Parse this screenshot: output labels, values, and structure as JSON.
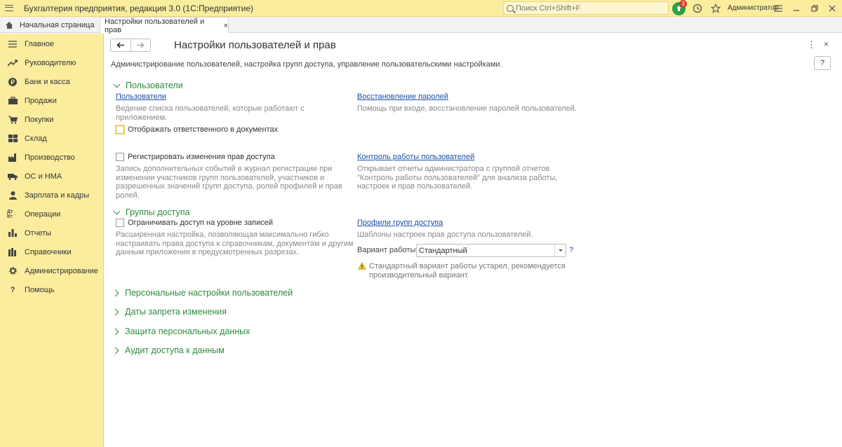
{
  "app": {
    "title": "Бухгалтерия предприятия, редакция 3.0  (1С:Предприятие)",
    "search_placeholder": "Поиск Ctrl+Shift+F",
    "notifications_count": "3",
    "user": "Администратор"
  },
  "tabs": {
    "home": "Начальная страница",
    "active": "Настройки пользователей и прав",
    "close": "×"
  },
  "sidebar": {
    "items": [
      {
        "label": "Главное",
        "icon": "menu-lines-icon"
      },
      {
        "label": "Руководителю",
        "icon": "trend-icon"
      },
      {
        "label": "Банк и касса",
        "icon": "ruble-icon"
      },
      {
        "label": "Продажи",
        "icon": "briefcase-icon"
      },
      {
        "label": "Покупки",
        "icon": "cart-icon"
      },
      {
        "label": "Склад",
        "icon": "warehouse-icon"
      },
      {
        "label": "Производство",
        "icon": "factory-icon"
      },
      {
        "label": "ОС и НМА",
        "icon": "truck-icon"
      },
      {
        "label": "Зарплата и кадры",
        "icon": "person-icon"
      },
      {
        "label": "Операции",
        "icon": "dt-kt-icon"
      },
      {
        "label": "Отчеты",
        "icon": "bar-chart-icon"
      },
      {
        "label": "Справочники",
        "icon": "books-icon"
      },
      {
        "label": "Администрирование",
        "icon": "gear-icon"
      },
      {
        "label": "Помощь",
        "icon": "question-icon"
      }
    ],
    "dt_kt": "Дт Кт"
  },
  "page": {
    "title": "Настройки пользователей и прав",
    "subtitle": "Администрирование пользователей, настройка групп доступа, управление пользовательскими настройками.",
    "help": "?",
    "more": "⋮",
    "close": "×"
  },
  "users_section": {
    "title": "Пользователи",
    "users_link": "Пользователи",
    "users_desc_1": "Ведение списка пользователей, которые работают с",
    "users_desc_2": "приложением.",
    "show_responsible": "Отображать ответственного в документах",
    "show_responsible_checked": false,
    "restore_link": "Восстановление паролей",
    "restore_desc": "Помощь при входе, восстановление паролей пользователей.",
    "register_changes": "Регистрировать изменения прав доступа",
    "register_changes_checked": false,
    "register_desc": [
      "Запись дополнительных событий в журнал регистрации при",
      "изменении участников групп пользователей, участников и",
      "разрешенных значений групп доступа, ролей профилей и прав",
      "ролей."
    ],
    "control_link": "Контроль работы пользователей",
    "control_desc": [
      "Открывает отчеты администратора с группой отчетов",
      "\"Контроль работы пользователей\" для анализа работы,",
      "настроек и прав пользователей."
    ]
  },
  "access_section": {
    "title": "Группы доступа",
    "restrict_records": "Ограничивать доступ на уровне записей",
    "restrict_records_checked": false,
    "restrict_desc": [
      "Расширенная настройка, позволяющая максимально гибко",
      "настраивать права доступа к справочникам, документам и другим",
      "данным приложения в предусмотренных разрезах."
    ],
    "profiles_link": "Профили групп доступа",
    "profiles_desc": "Шаблоны настроек прав доступа пользователей.",
    "mode_label": "Вариант работы:",
    "mode_value": "Стандартный",
    "mode_help": "?",
    "warning": [
      "Стандартный вариант работы устарел, рекомендуется",
      "производительный вариант."
    ]
  },
  "collapsed_sections": [
    "Персональные настройки пользователей",
    "Даты запрета изменения",
    "Защита персональных данных",
    "Аудит доступа к данным"
  ],
  "colors": {
    "accent_green": "#2e8b3d",
    "link_blue": "#1c4fa1",
    "panel_yellow": "#fbed9e"
  }
}
